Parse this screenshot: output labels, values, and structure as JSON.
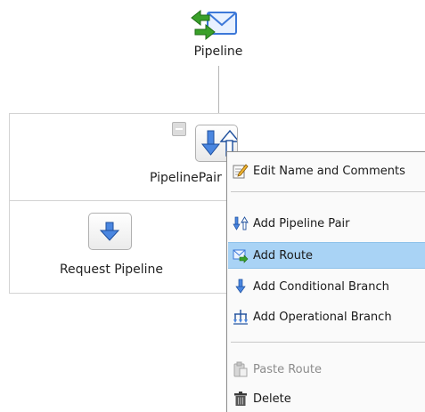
{
  "pipeline": {
    "label": "Pipeline"
  },
  "pipeline_pair": {
    "label": "PipelinePair"
  },
  "request_pipeline": {
    "label": "Request Pipeline"
  },
  "context_menu": {
    "items": [
      {
        "label": "Edit Name and Comments",
        "icon": "edit-icon",
        "state": "normal"
      },
      {
        "label": "Add Pipeline Pair",
        "icon": "pipeline-pair-icon",
        "state": "normal"
      },
      {
        "label": "Add Route",
        "icon": "route-icon",
        "state": "highlighted"
      },
      {
        "label": "Add Conditional Branch",
        "icon": "conditional-branch-icon",
        "state": "normal"
      },
      {
        "label": "Add Operational Branch",
        "icon": "operational-branch-icon",
        "state": "normal"
      },
      {
        "label": "Paste Route",
        "icon": "paste-icon",
        "state": "disabled"
      },
      {
        "label": "Delete",
        "icon": "trash-icon",
        "state": "normal"
      }
    ]
  },
  "colors": {
    "menu_highlight": "#a9d3f5",
    "arrow_blue": "#2f6fd0",
    "pipeline_green": "#3aa02a",
    "envelope_blue": "#3c78d8"
  }
}
